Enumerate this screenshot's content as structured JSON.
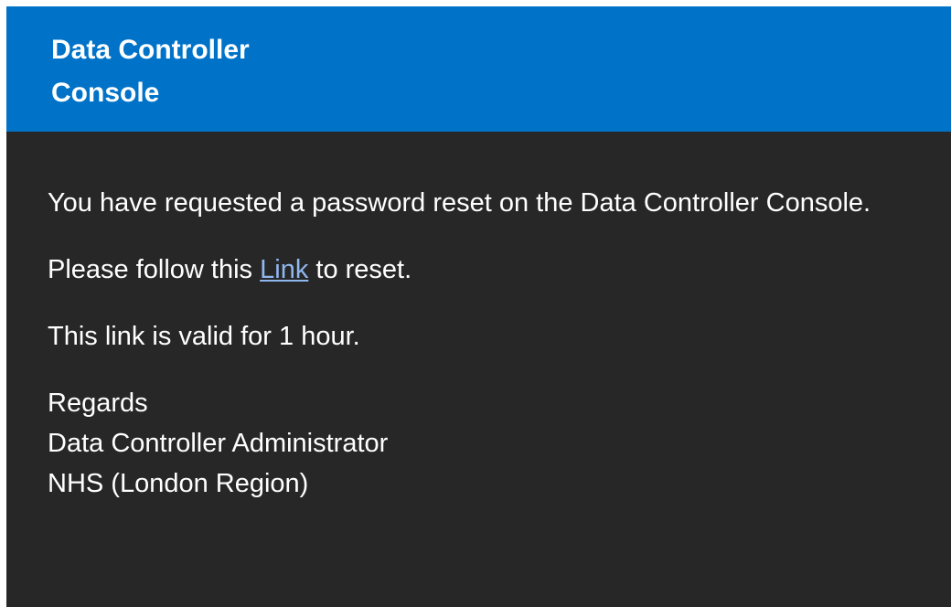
{
  "header": {
    "title": "Data Controller Console"
  },
  "message": {
    "intro": "You have requested a password reset on the Data Controller Console.",
    "follow_prefix": "Please follow this ",
    "link_label": "Link",
    "follow_suffix": " to reset.",
    "validity": "This link is valid for 1 hour.",
    "signature": {
      "regards": "Regards",
      "name": "Data Controller Administrator",
      "organization": "NHS (London Region)"
    }
  },
  "colors": {
    "header_background": "#0073c9",
    "body_background": "#272727",
    "text": "#ffffff",
    "link": "#8fb8ee"
  }
}
